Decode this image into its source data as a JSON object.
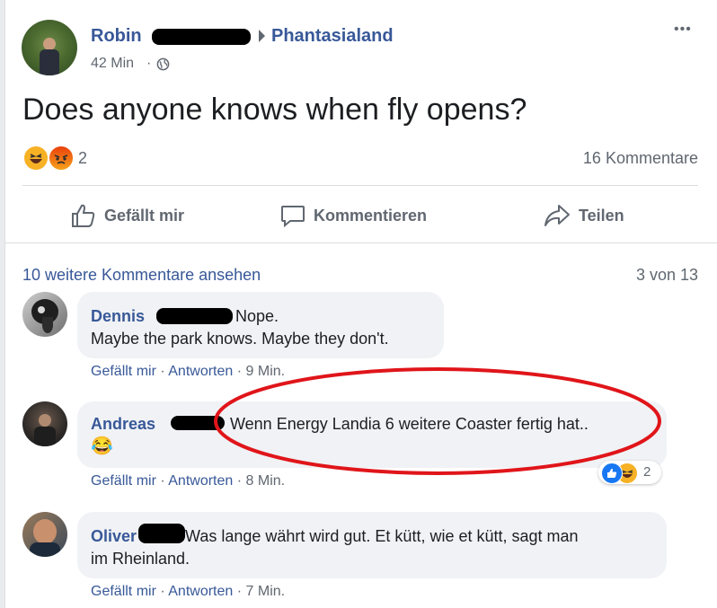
{
  "post": {
    "author": "Robin",
    "group": "Phantasialand",
    "time": "42 Min",
    "time_sep": "·",
    "more": "•••",
    "text": "Does anyone knows when fly opens?",
    "reaction_count": "2",
    "comments_count": "16 Kommentare"
  },
  "actions": {
    "like": "Gefällt mir",
    "comment": "Kommentieren",
    "share": "Teilen"
  },
  "comments_section": {
    "more_comments": "10 weitere Kommentare ansehen",
    "page_indicator": "3 von 13"
  },
  "comments": [
    {
      "name": "Dennis",
      "text_line1": "Nope.",
      "text_line2": "Maybe the park knows. Maybe they don't.",
      "like": "Gefällt mir",
      "reply": "Antworten",
      "time": "9 Min."
    },
    {
      "name": "Andreas",
      "text_line1": "Wenn Energy Landia 6 weitere Coaster fertig hat..",
      "emoji": "😂",
      "like": "Gefällt mir",
      "reply": "Antworten",
      "time": "8 Min.",
      "reaction_count": "2"
    },
    {
      "name": "Oliver",
      "text_line1": "Was lange währt wird gut. Et kütt, wie et kütt, sagt man",
      "text_line2": "im Rheinland.",
      "like": "Gefällt mir",
      "reply": "Antworten",
      "time": "7 Min."
    }
  ],
  "meta_sep": "·",
  "colors": {
    "link": "#385898",
    "secondary": "#606770",
    "bubble": "#f0f2f5",
    "annotation": "#e0151a"
  }
}
